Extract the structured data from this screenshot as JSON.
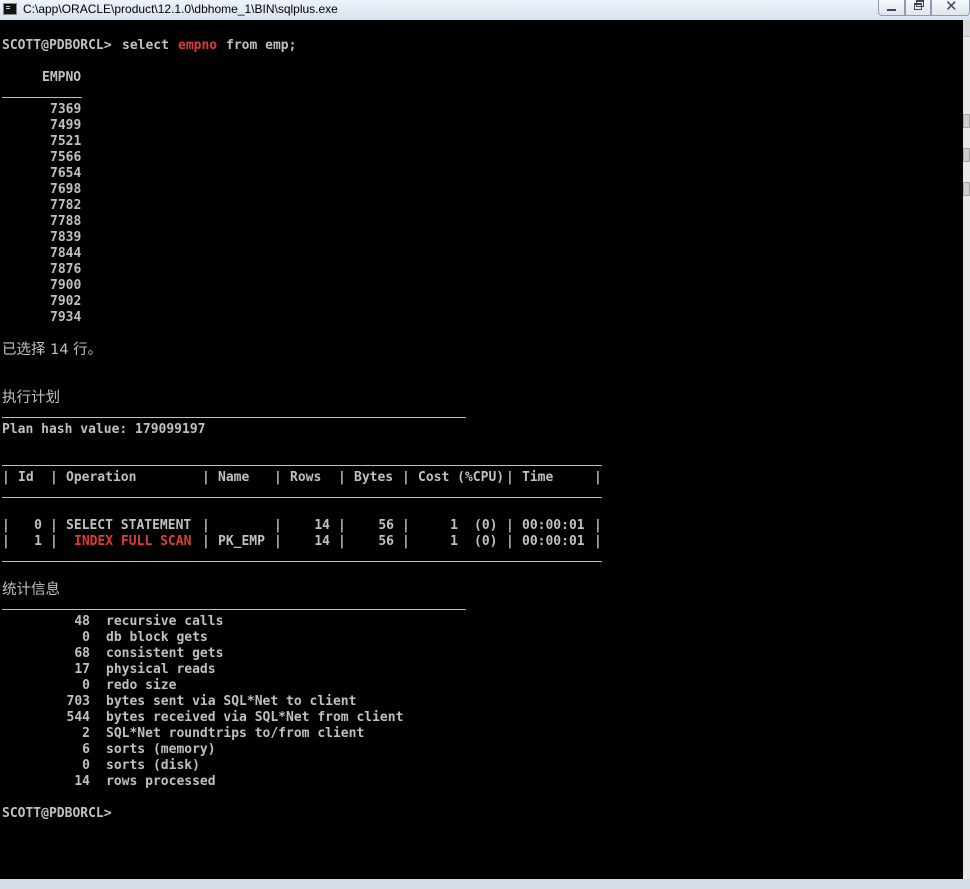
{
  "window": {
    "title": "C:\\app\\ORACLE\\product\\12.1.0\\dbhome_1\\BIN\\sqlplus.exe",
    "buttons": [
      "minimize",
      "maximize",
      "close"
    ]
  },
  "colors": {
    "console_bg": "#000000",
    "console_text": "#c0c0c0",
    "highlight": "#e03a3a"
  },
  "prompt": "SCOTT@PDBORCL>",
  "query": {
    "keyword1": "select",
    "column": "empno",
    "rest": "from emp;"
  },
  "result": {
    "header": "EMPNO",
    "rows": [
      "7369",
      "7499",
      "7521",
      "7566",
      "7654",
      "7698",
      "7782",
      "7788",
      "7839",
      "7844",
      "7876",
      "7900",
      "7902",
      "7934"
    ],
    "summary": "已选择 14 行。"
  },
  "plan": {
    "heading": "执行计划",
    "hash_line": "Plan hash value: 179099197",
    "header": {
      "id": "Id",
      "operation": "Operation",
      "name": "Name",
      "rows": "Rows",
      "bytes": "Bytes",
      "cost": "Cost (%CPU)",
      "time": "Time"
    },
    "rows": [
      {
        "id": "0",
        "operation": "SELECT STATEMENT",
        "name": "",
        "rows": "14",
        "bytes": "56",
        "cost": "1",
        "cpu": "(0)",
        "time": "00:00:01"
      },
      {
        "id": "1",
        "operation": "INDEX FULL SCAN",
        "name": "PK_EMP",
        "rows": "14",
        "bytes": "56",
        "cost": "1",
        "cpu": "(0)",
        "time": "00:00:01"
      }
    ]
  },
  "stats": {
    "heading": "统计信息",
    "rows": [
      {
        "value": "48",
        "label": "recursive calls"
      },
      {
        "value": "0",
        "label": "db block gets"
      },
      {
        "value": "68",
        "label": "consistent gets"
      },
      {
        "value": "17",
        "label": "physical reads"
      },
      {
        "value": "0",
        "label": "redo size"
      },
      {
        "value": "703",
        "label": "bytes sent via SQL*Net to client"
      },
      {
        "value": "544",
        "label": "bytes received via SQL*Net from client"
      },
      {
        "value": "2",
        "label": "SQL*Net roundtrips to/from client"
      },
      {
        "value": "6",
        "label": "sorts (memory)"
      },
      {
        "value": "0",
        "label": "sorts (disk)"
      },
      {
        "value": "14",
        "label": "rows processed"
      }
    ]
  }
}
